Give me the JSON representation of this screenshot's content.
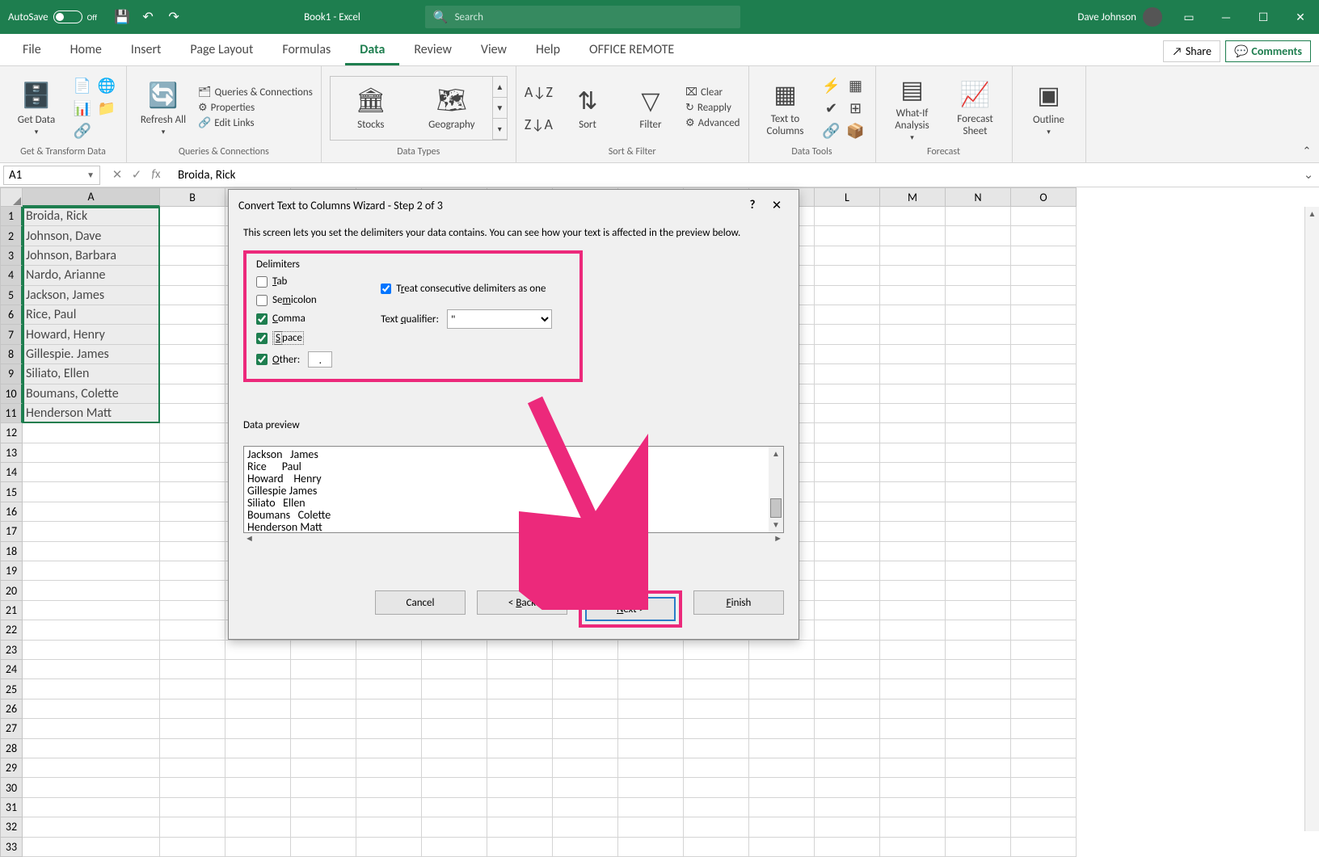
{
  "titlebar": {
    "autosave_label": "AutoSave",
    "autosave_state": "Off",
    "book_title": "Book1 - Excel",
    "search_placeholder": "Search",
    "user_name": "Dave Johnson"
  },
  "tabs": {
    "file": "File",
    "home": "Home",
    "insert": "Insert",
    "page_layout": "Page Layout",
    "formulas": "Formulas",
    "data": "Data",
    "review": "Review",
    "view": "View",
    "help": "Help",
    "office_remote": "OFFICE REMOTE",
    "share": "Share",
    "comments": "Comments"
  },
  "ribbon": {
    "get_data": "Get Data",
    "group_get_transform": "Get & Transform Data",
    "refresh_all": "Refresh All",
    "queries_connections": "Queries & Connections",
    "properties": "Properties",
    "edit_links": "Edit Links",
    "group_queries": "Queries & Connections",
    "stocks": "Stocks",
    "geography": "Geography",
    "group_datatypes": "Data Types",
    "sort": "Sort",
    "filter": "Filter",
    "clear": "Clear",
    "reapply": "Reapply",
    "advanced": "Advanced",
    "group_sortfilter": "Sort & Filter",
    "text_to_columns": "Text to Columns",
    "group_datatools": "Data Tools",
    "what_if": "What-If Analysis",
    "forecast_sheet": "Forecast Sheet",
    "group_forecast": "Forecast",
    "outline": "Outline"
  },
  "formula_bar": {
    "name_box": "A1",
    "formula": "Broida, Rick"
  },
  "columns": [
    "A",
    "B",
    "L",
    "M",
    "N",
    "O"
  ],
  "rows": [
    "1",
    "2",
    "3",
    "4",
    "5",
    "6",
    "7",
    "8",
    "9",
    "10",
    "11",
    "12",
    "13",
    "14",
    "15",
    "16",
    "17",
    "18",
    "19",
    "20",
    "21",
    "22",
    "23",
    "24"
  ],
  "cell_data": [
    "Broida, Rick",
    "Johnson, Dave",
    "Johnson, Barbara",
    "Nardo, Arianne",
    "Jackson, James",
    "Rice, Paul",
    "Howard, Henry",
    "Gillespie. James",
    "Siliato, Ellen",
    "Boumans, Colette",
    "Henderson Matt"
  ],
  "dialog": {
    "title": "Convert Text to Columns Wizard - Step 2 of 3",
    "subtitle": "This screen lets you set the delimiters your data contains.  You can see how your text is affected in the preview below.",
    "delimiters_label": "Delimiters",
    "tab": "Tab",
    "semicolon": "Semicolon",
    "comma": "Comma",
    "space": "Space",
    "other": "Other:",
    "other_value": ".",
    "treat_consecutive": "Treat consecutive delimiters as one",
    "text_qualifier_label": "Text qualifier:",
    "text_qualifier_value": "\"",
    "preview_label": "Data preview",
    "preview_text": "Jackson   James\nRice      Paul\nHoward    Henry\nGillespie James\nSiliato   Ellen\nBoumans   Colette\nHenderson Matt",
    "btn_cancel": "Cancel",
    "btn_back": "< Back",
    "btn_next": "Next >",
    "btn_finish": "Finish"
  }
}
